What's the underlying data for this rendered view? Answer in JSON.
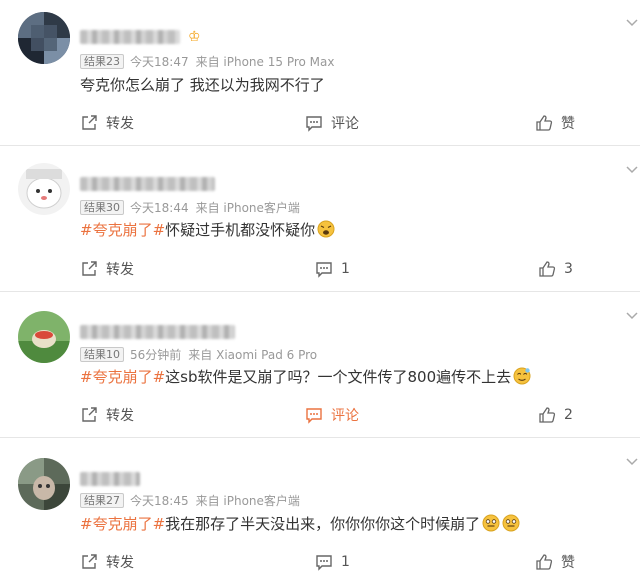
{
  "accent_color": "#eb7340",
  "comments": [
    {
      "level": "结果23",
      "time": "今天18:47",
      "source": "来自 iPhone 15 Pro Max",
      "text": "夸克你怎么崩了 我还以为我网不行了",
      "tag": "",
      "repost_label": "转发",
      "comment_label": "评论",
      "like_label": "赞",
      "vip_icon": "crown-badge-icon"
    },
    {
      "level": "结果30",
      "time": "今天18:44",
      "source": "来自 iPhone客户端",
      "tag": "#夸克崩了#",
      "text": "怀疑过手机都没怀疑你",
      "emoji": "angry-face-emoji",
      "repost_label": "转发",
      "comment_count": "1",
      "like_count": "3"
    },
    {
      "level": "结果10",
      "time": "56分钟前",
      "source": "来自 Xiaomi Pad 6 Pro",
      "tag": "#夸克崩了#",
      "text": "这sb软件是又崩了吗？一个文件传了800遍传不上去",
      "emoji": "dizzy-face-emoji",
      "repost_label": "转发",
      "comment_label": "评论",
      "comment_active": true,
      "like_count": "2"
    },
    {
      "level": "结果27",
      "time": "今天18:45",
      "source": "来自 iPhone客户端",
      "tag": "#夸克崩了#",
      "text": "我在那存了半天没出来，你你你你这个时候崩了",
      "emoji": "awkward-smile-emoji",
      "repost_label": "转发",
      "comment_count": "1",
      "like_label": "赞"
    }
  ]
}
